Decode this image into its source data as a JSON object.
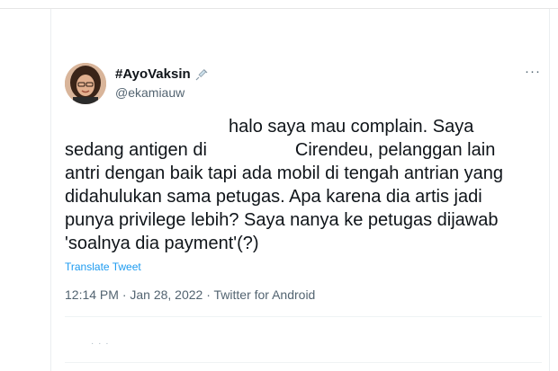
{
  "tweet": {
    "display_name": "#AyoVaksin",
    "handle": "@ekamiauw",
    "more_label": "···",
    "text_lines": [
      "halo saya mau complain. Saya",
      "sedang antigen di",
      "Cirendeu, pelanggan lain",
      "antri dengan baik tapi ada mobil di tengah antrian yang",
      "didahulukan sama petugas. Apa karena dia artis jadi",
      "punya privilege lebih? Saya nanya ke petugas dijawab",
      "'soalnya dia payment'(?)"
    ],
    "translate_label": "Translate Tweet",
    "meta": "12:14 PM · Jan 28, 2022 · Twitter for Android",
    "loading_dots": "· · ·"
  },
  "icons": {
    "name_badge": "syringe-icon",
    "more": "more-options-icon",
    "avatar": "profile-photo"
  },
  "colors": {
    "link": "#1d9bf0",
    "secondary_text": "#536471",
    "primary_text": "#0f1419"
  }
}
